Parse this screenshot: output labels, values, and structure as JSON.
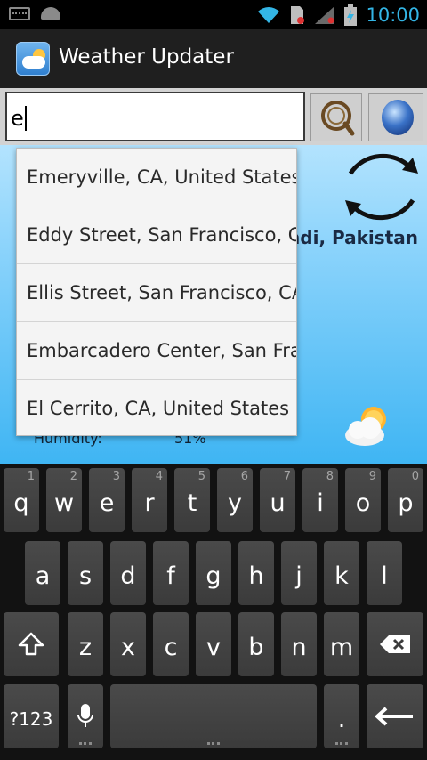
{
  "status_bar": {
    "time": "10:00"
  },
  "app_bar": {
    "title": "Weather Updater"
  },
  "search": {
    "value": "e"
  },
  "suggestions": [
    "Emeryville, CA, United States",
    "Eddy Street, San Francisco, CA",
    "Ellis Street, San Francisco, CA",
    "Embarcadero Center, San Francisco",
    "El Cerrito, CA, United States"
  ],
  "weather": {
    "city": "ndi, Pakistan",
    "humidity_label": "Humidity:",
    "humidity_value": "51%"
  },
  "keyboard": {
    "row1": [
      {
        "label": "q",
        "num": "1"
      },
      {
        "label": "w",
        "num": "2"
      },
      {
        "label": "e",
        "num": "3"
      },
      {
        "label": "r",
        "num": "4"
      },
      {
        "label": "t",
        "num": "5"
      },
      {
        "label": "y",
        "num": "6"
      },
      {
        "label": "u",
        "num": "7"
      },
      {
        "label": "i",
        "num": "8"
      },
      {
        "label": "o",
        "num": "9"
      },
      {
        "label": "p",
        "num": "0"
      }
    ],
    "row2": [
      "a",
      "s",
      "d",
      "f",
      "g",
      "h",
      "j",
      "k",
      "l"
    ],
    "row3": [
      "z",
      "x",
      "c",
      "v",
      "b",
      "n",
      "m"
    ],
    "symbols_label": "?123",
    "period_label": "."
  }
}
